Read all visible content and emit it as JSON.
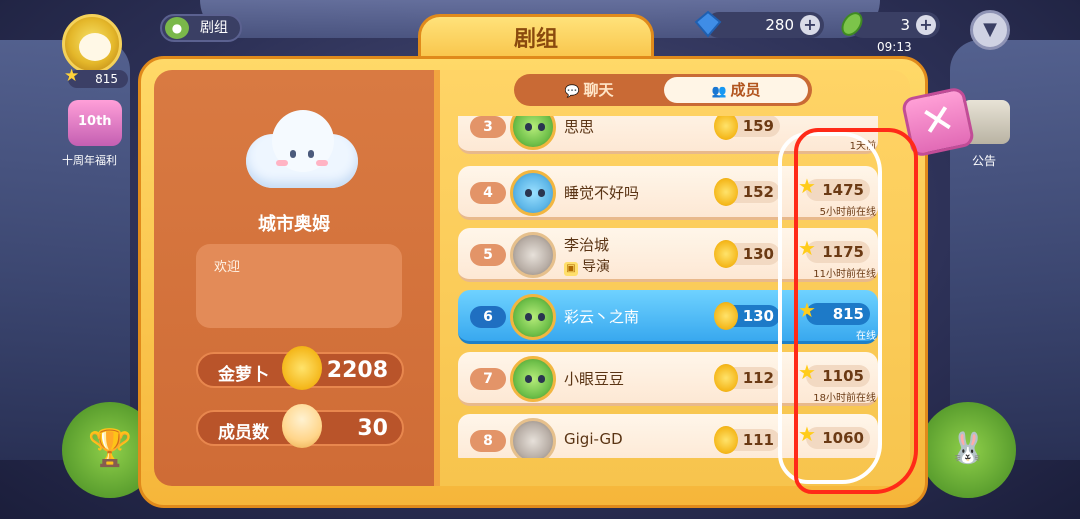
{
  "hud": {
    "level": "815",
    "troupe_button": "剧组",
    "gift_title": "10th",
    "gift_label": "十周年福利",
    "gems": "280",
    "leaves": "3",
    "clock": "09:13",
    "notice_label": "公告"
  },
  "panel": {
    "title": "剧组",
    "troupe_name": "城市奥姆",
    "welcome": "欢迎",
    "carrot_label": "金萝卜",
    "carrot_value": "2208",
    "members_label": "成员数",
    "members_value": "30"
  },
  "tabs": {
    "chat": "聊天",
    "members": "成员"
  },
  "members": [
    {
      "rank": "3",
      "name": "思思",
      "carrots": "159",
      "score": "",
      "status": "1天前"
    },
    {
      "rank": "4",
      "name": "睡觉不好吗",
      "carrots": "152",
      "score": "1475",
      "status": "5小时前在线"
    },
    {
      "rank": "5",
      "name": "李治城",
      "role": "导演",
      "carrots": "130",
      "score": "1175",
      "status": "11小时前在线"
    },
    {
      "rank": "6",
      "name": "彩云丶之南",
      "carrots": "130",
      "score": "815",
      "status": "在线"
    },
    {
      "rank": "7",
      "name": "小眼豆豆",
      "carrots": "112",
      "score": "1105",
      "status": "18小时前在线"
    },
    {
      "rank": "8",
      "name": "Gigi-GD",
      "carrots": "111",
      "score": "1060",
      "status": ""
    }
  ],
  "colors": {
    "panel_orange": "#d97a42",
    "highlight_row": "#38a8ef",
    "annotation_red": "#ff2a18",
    "annotation_white": "#ffffff"
  }
}
